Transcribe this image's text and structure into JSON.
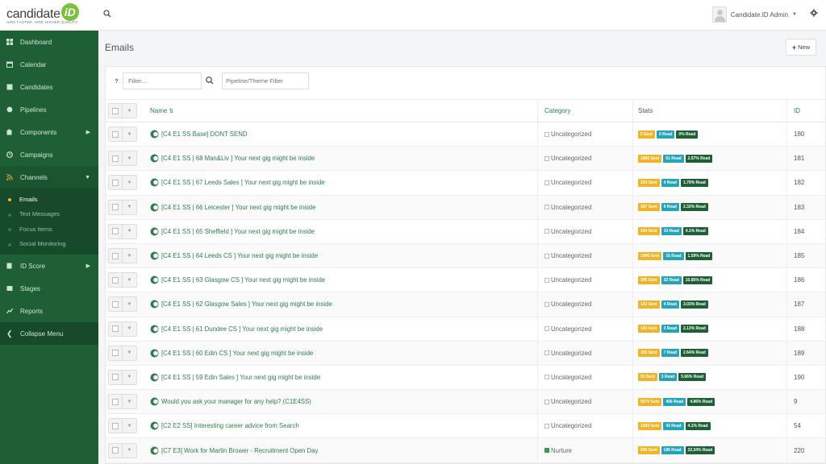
{
  "brand": {
    "name": "candidate",
    "mark": "iD",
    "tagline": "HIRE FASTER, HIRE HIGHER QUALITY"
  },
  "header": {
    "user_name": "Candidate.ID Admin"
  },
  "sidebar": {
    "items": [
      {
        "label": "Dashboard",
        "icon": "dashboard-icon"
      },
      {
        "label": "Calendar",
        "icon": "calendar-icon"
      },
      {
        "label": "Candidates",
        "icon": "users-icon"
      },
      {
        "label": "Pipelines",
        "icon": "pipeline-icon"
      },
      {
        "label": "Components",
        "icon": "puzzle-icon"
      },
      {
        "label": "Campaigns",
        "icon": "clock-icon"
      },
      {
        "label": "Channels",
        "icon": "rss-icon"
      }
    ],
    "sub_items": [
      {
        "label": "Emails"
      },
      {
        "label": "Text Messages"
      },
      {
        "label": "Focus Items"
      },
      {
        "label": "Social Monitoring"
      }
    ],
    "items_after": [
      {
        "label": "ID Score",
        "icon": "id-card-icon"
      },
      {
        "label": "Stages",
        "icon": "layers-icon"
      },
      {
        "label": "Reports",
        "icon": "line-chart-icon"
      }
    ],
    "collapse_label": "Collapse Menu"
  },
  "page": {
    "title": "Emails",
    "new_label": "New",
    "filter_placeholder": "Filter...",
    "pipeline_placeholder": "Pipeline/Theme Filter"
  },
  "table": {
    "headers": {
      "name": "Name",
      "category": "Category",
      "stats": "Stats",
      "id": "ID"
    },
    "rows": [
      {
        "name": "[C4 E1 SS Base] DONT SEND",
        "category": "Uncategorized",
        "sent": "0 Sent",
        "read": "0 Read",
        "pct": "0% Read",
        "id": "180"
      },
      {
        "name": "[C4 E1 SS | 68 Man&Liv ] Your next gig might be inside",
        "category": "Uncategorized",
        "sent": "1966 Sent",
        "read": "51 Read",
        "pct": "2.57% Read",
        "id": "181"
      },
      {
        "name": "[C4 E1 SS | 67 Leeds Sales ] Your next gig might be inside",
        "category": "Uncategorized",
        "sent": "224 Sent",
        "read": "4 Read",
        "pct": "1.79% Read",
        "id": "182"
      },
      {
        "name": "[C4 E1 SS | 66 Leicester ] Your next gig might be inside",
        "category": "Uncategorized",
        "sent": "397 Sent",
        "read": "9 Read",
        "pct": "2.33% Read",
        "id": "183"
      },
      {
        "name": "[C4 E1 SS | 65 Sheffield ] Your next gig might be inside",
        "category": "Uncategorized",
        "sent": "244 Sent",
        "read": "10 Read",
        "pct": "4.1% Read",
        "id": "184"
      },
      {
        "name": "[C4 E1 SS | 64 Leeds CS ] Your next gig might be inside",
        "category": "Uncategorized",
        "sent": "1006 Sent",
        "read": "16 Read",
        "pct": "1.59% Read",
        "id": "185"
      },
      {
        "name": "[C4 E1 SS | 63 Glasgow CS ] Your next gig might be inside",
        "category": "Uncategorized",
        "sent": "295 Sent",
        "read": "32 Read",
        "pct": "10.85% Read",
        "id": "186"
      },
      {
        "name": "[C4 E1 SS | 62 Glasgow Sales ] Your next gig might be inside",
        "category": "Uncategorized",
        "sent": "132 Sent",
        "read": "4 Read",
        "pct": "3.03% Read",
        "id": "187"
      },
      {
        "name": "[C4 E1 SS | 61 Dundee CS ] Your next gig might be inside",
        "category": "Uncategorized",
        "sent": "141 Sent",
        "read": "3 Read",
        "pct": "2.13% Read",
        "id": "188"
      },
      {
        "name": "[C4 E1 SS | 60 Edin CS ] Your next gig might be inside",
        "category": "Uncategorized",
        "sent": "265 Sent",
        "read": "7 Read",
        "pct": "2.64% Read",
        "id": "189"
      },
      {
        "name": "[C4 E1 SS | 59 Edin Sales ] Your next gig might be inside",
        "category": "Uncategorized",
        "sent": "53 Sent",
        "read": "3 Read",
        "pct": "5.66% Read",
        "id": "190"
      },
      {
        "name": "Would you ask your manager for any help? (C1E4SS)",
        "category": "Uncategorized",
        "sent": "9370 Sent",
        "read": "456 Read",
        "pct": "4.86% Read",
        "id": "9"
      },
      {
        "name": "[C2 E2 SS] Interesting career advice from Search",
        "category": "Uncategorized",
        "sent": "1050 Sent",
        "read": "43 Read",
        "pct": "4.1% Read",
        "id": "54"
      },
      {
        "name": "[C7 E3] Work for Martin Brower - Recruitment Open Day",
        "category": "Nurture",
        "sent": "606 Sent",
        "read": "196 Read",
        "pct": "32.34% Read",
        "id": "220"
      }
    ]
  },
  "colors": {
    "sidebar_bg": "#1e5f35",
    "accent_green": "#2e7d4f",
    "sent_badge": "#f0b429",
    "read_badge": "#27a3b8",
    "pct_badge": "#1e5f35",
    "active_dot": "#f0b429"
  }
}
